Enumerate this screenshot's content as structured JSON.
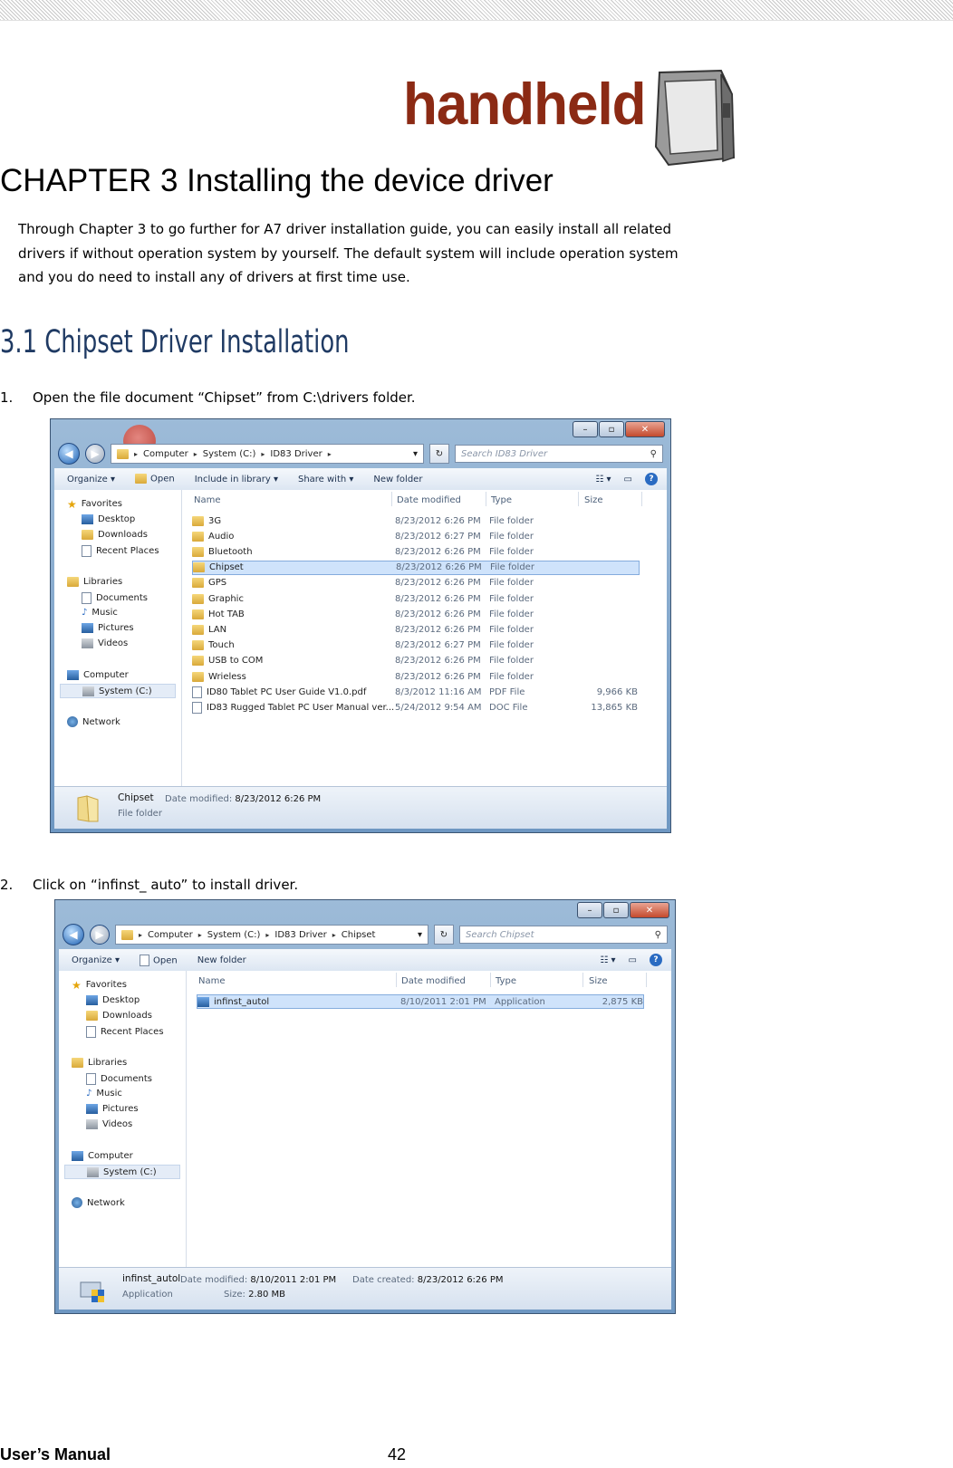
{
  "logo": {
    "text": "handheld"
  },
  "chapter_title": "CHAPTER 3 Installing the device driver",
  "intro": [
    "Through Chapter 3 to go further for A7 driver installation guide, you can easily install all related",
    "drivers if without operation system by yourself. The default system will include operation system",
    "and you do need to install any of drivers at first time use."
  ],
  "section_title": "3.1 Chipset Driver Installation",
  "steps": [
    {
      "num": "1.",
      "text": "Open the file document “Chipset” from C:\\drivers folder."
    },
    {
      "num": "2.",
      "text": "Click on “infinst_ auto” to install driver."
    }
  ],
  "window1": {
    "breadcrumb": [
      "Computer",
      "System (C:)",
      "ID83 Driver"
    ],
    "search_placeholder": "Search ID83 Driver",
    "toolbar": [
      "Organize ▾",
      "Open",
      "Include in library ▾",
      "Share with ▾",
      "New folder"
    ],
    "nav": {
      "favorites": "Favorites",
      "desktop": "Desktop",
      "downloads": "Downloads",
      "recent": "Recent Places",
      "libraries": "Libraries",
      "documents": "Documents",
      "music": "Music",
      "pictures": "Pictures",
      "videos": "Videos",
      "computer": "Computer",
      "system": "System (C:)",
      "network": "Network"
    },
    "columns": [
      "Name",
      "Date modified",
      "Type",
      "Size"
    ],
    "rows": [
      {
        "name": "3G",
        "date": "8/23/2012 6:26 PM",
        "type": "File folder",
        "size": ""
      },
      {
        "name": "Audio",
        "date": "8/23/2012 6:27 PM",
        "type": "File folder",
        "size": ""
      },
      {
        "name": "Bluetooth",
        "date": "8/23/2012 6:26 PM",
        "type": "File folder",
        "size": ""
      },
      {
        "name": "Chipset",
        "date": "8/23/2012 6:26 PM",
        "type": "File folder",
        "size": ""
      },
      {
        "name": "GPS",
        "date": "8/23/2012 6:26 PM",
        "type": "File folder",
        "size": ""
      },
      {
        "name": "Graphic",
        "date": "8/23/2012 6:26 PM",
        "type": "File folder",
        "size": ""
      },
      {
        "name": "Hot TAB",
        "date": "8/23/2012 6:26 PM",
        "type": "File folder",
        "size": ""
      },
      {
        "name": "LAN",
        "date": "8/23/2012 6:26 PM",
        "type": "File folder",
        "size": ""
      },
      {
        "name": "Touch",
        "date": "8/23/2012 6:27 PM",
        "type": "File folder",
        "size": ""
      },
      {
        "name": "USB to COM",
        "date": "8/23/2012 6:26 PM",
        "type": "File folder",
        "size": ""
      },
      {
        "name": "Wrieless",
        "date": "8/23/2012 6:26 PM",
        "type": "File folder",
        "size": ""
      },
      {
        "name": "ID80 Tablet PC User Guide V1.0.pdf",
        "date": "8/3/2012 11:16 AM",
        "type": "PDF File",
        "size": "9,966 KB"
      },
      {
        "name": "ID83 Rugged Tablet PC  User Manual ver...",
        "date": "5/24/2012 9:54 AM",
        "type": "DOC File",
        "size": "13,865 KB"
      }
    ],
    "details": {
      "name": "Chipset",
      "date_label": "Date modified:",
      "date": "8/23/2012 6:26 PM",
      "type": "File folder"
    }
  },
  "window2": {
    "breadcrumb": [
      "Computer",
      "System (C:)",
      "ID83 Driver",
      "Chipset"
    ],
    "search_placeholder": "Search Chipset",
    "toolbar": [
      "Organize ▾",
      "Open",
      "New folder"
    ],
    "columns": [
      "Name",
      "Date modified",
      "Type",
      "Size"
    ],
    "rows": [
      {
        "name": "infinst_autol",
        "date": "8/10/2011 2:01 PM",
        "type": "Application",
        "size": "2,875 KB"
      }
    ],
    "details": {
      "name": "infinst_autol",
      "date_label": "Date modified:",
      "date": "8/10/2011 2:01 PM",
      "created_label": "Date created:",
      "created": "8/23/2012 6:26 PM",
      "type": "Application",
      "size_label": "Size:",
      "size": "2.80 MB"
    }
  },
  "footer": {
    "left": "User’s Manual",
    "page": "42"
  }
}
